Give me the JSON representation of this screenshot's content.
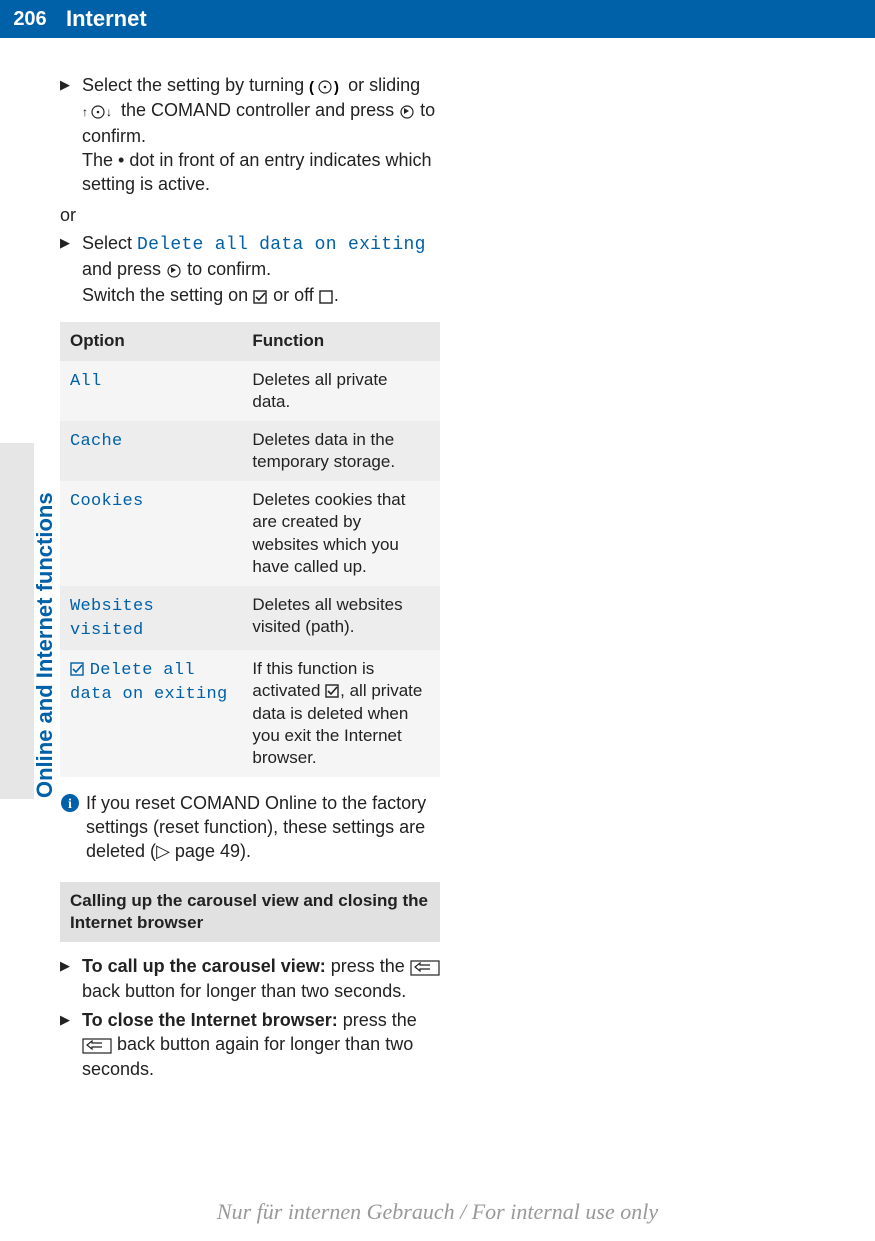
{
  "header": {
    "page": "206",
    "title": "Internet"
  },
  "side_label": "Online and Internet functions",
  "steps": {
    "s1a": "Select the setting by turning ",
    "s1b": " or sliding ",
    "s1c": " the COMAND controller and press ",
    "s1d": " to confirm.",
    "s1e": "The • dot in front of an entry indicates which setting is active."
  },
  "or": "or",
  "step2": {
    "a": "Select ",
    "ui": "Delete all data on exiting",
    "b": " and press ",
    "c": " to confirm.",
    "d": "Switch the setting on ",
    "e": " or off ",
    "f": "."
  },
  "table": {
    "h1": "Option",
    "h2": "Function",
    "rows": [
      {
        "opt": "All",
        "fn": "Deletes all private data."
      },
      {
        "opt": "Cache",
        "fn": "Deletes data in the temporary storage."
      },
      {
        "opt": "Cookies",
        "fn": "Deletes cookies that are created by websites which you have called up."
      },
      {
        "opt": "Websites visited",
        "fn": "Deletes all websites visited (path)."
      },
      {
        "opt": "Delete all data on exiting",
        "fn_a": "If this function is activated ",
        "fn_b": ", all private data is deleted when you exit the Internet browser."
      }
    ]
  },
  "info_note": {
    "a": "If you reset COMAND Online to the factory settings (reset function), these settings are deleted (",
    "b": " page 49)."
  },
  "subheading": "Calling up the carousel view and closing the Internet browser",
  "step3": {
    "bold": "To call up the carousel view:",
    "rest": " press the ",
    "tail": " back button for longer than two seconds."
  },
  "step4": {
    "bold": "To close the Internet browser:",
    "rest": " press the ",
    "tail": " back button again for longer than two seconds."
  },
  "watermark": "Nur für internen Gebrauch / For internal use only"
}
